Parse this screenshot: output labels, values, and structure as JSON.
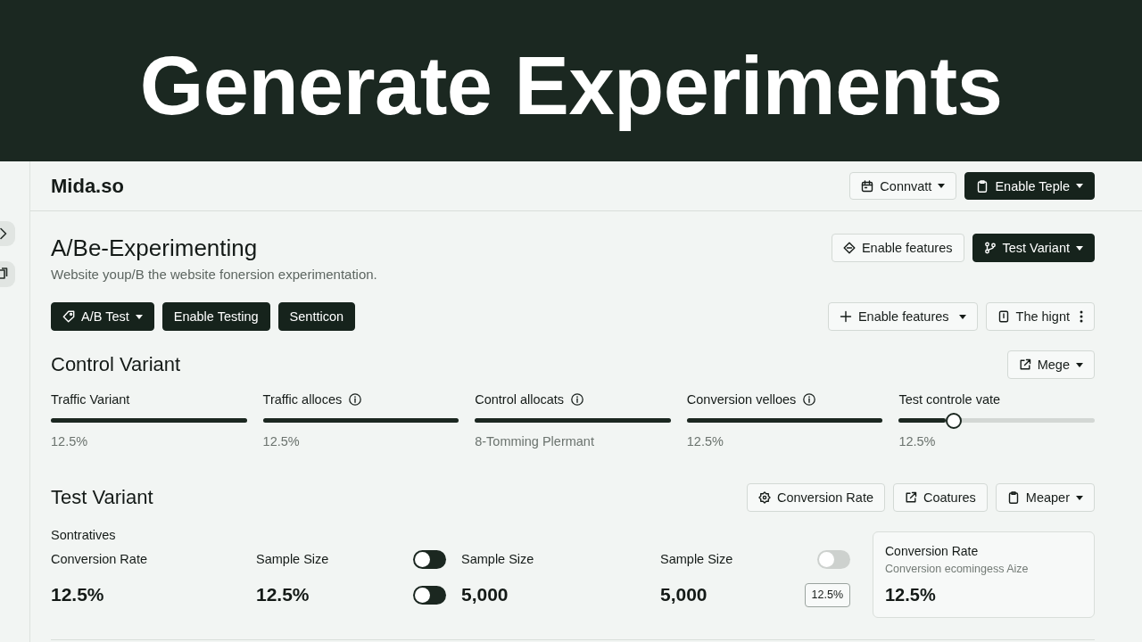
{
  "banner": {
    "title": "Generate Experiments"
  },
  "header": {
    "brand": "Mida.so",
    "buttons": [
      {
        "label": "Connvatt",
        "kind": "outline",
        "dropdown": true
      },
      {
        "label": "Enable Teple",
        "kind": "dark",
        "dropdown": true
      }
    ]
  },
  "experiment": {
    "title": "A/Be-Experimenting",
    "subtitle": "Website youp/B the website fonersion experimentation.",
    "actions": [
      {
        "label": "Enable features",
        "kind": "outline",
        "dropdown": false
      },
      {
        "label": "Test Variant",
        "kind": "dark",
        "dropdown": true
      }
    ],
    "toolbar": [
      {
        "label": "A/B Test",
        "kind": "dark",
        "dropdown": true
      },
      {
        "label": "Enable Testing",
        "kind": "dark",
        "dropdown": false
      },
      {
        "label": "Sentticon",
        "kind": "dark",
        "dropdown": false
      }
    ],
    "toolbar_right": [
      {
        "label": "Enable features",
        "kind": "outline",
        "dropdown": true,
        "more": false
      },
      {
        "label": "The hignt",
        "kind": "outline",
        "dropdown": false,
        "more": true
      }
    ]
  },
  "control_variant": {
    "title": "Control Variant",
    "actions": [
      {
        "label": "Mege",
        "kind": "outline",
        "dropdown": true
      }
    ],
    "sliders": [
      {
        "label": "Traffic Variant",
        "info": false,
        "kind": "bar",
        "level": 1,
        "reading": "12.5%"
      },
      {
        "label": "Traffic alloces",
        "info": true,
        "kind": "bar",
        "level": 1,
        "reading": "12.5%"
      },
      {
        "label": "Control allocats",
        "info": true,
        "kind": "bar",
        "level": 1,
        "reading": "8-Tomming Plermant"
      },
      {
        "label": "Conversion velloes",
        "info": true,
        "kind": "bar",
        "level": 1,
        "reading": "12.5%"
      },
      {
        "label": "Test controle vate",
        "info": false,
        "kind": "slider",
        "level": 0.28,
        "reading": "12.5%"
      }
    ]
  },
  "test_variant": {
    "title": "Test Variant",
    "actions": [
      {
        "label": "Conversion Rate",
        "kind": "outline",
        "dropdown": false
      },
      {
        "label": "Coatures",
        "kind": "outline",
        "dropdown": false
      },
      {
        "label": "Meaper",
        "kind": "outline",
        "dropdown": true
      }
    ],
    "group_label": "Sontratives",
    "metrics": [
      {
        "cells": [
          {
            "kind": "label",
            "text": "Conversion Rate"
          },
          {
            "kind": "label",
            "text": "Sample Size"
          },
          {
            "kind": "toggle",
            "on": false,
            "disabled": false
          },
          {
            "kind": "label",
            "text": "Sample Size"
          },
          {
            "kind": "label",
            "text": "Sample Size"
          },
          {
            "kind": "toggle",
            "on": false,
            "disabled": true
          }
        ]
      },
      {
        "cells": [
          {
            "kind": "value",
            "text": "12.5%"
          },
          {
            "kind": "value",
            "text": "12.5%"
          },
          {
            "kind": "toggle",
            "on": false,
            "disabled": false
          },
          {
            "kind": "value",
            "text": "5,000"
          },
          {
            "kind": "value",
            "text": "5,000"
          },
          {
            "kind": "badge",
            "text": "12.5%"
          }
        ]
      }
    ],
    "card": {
      "title": "Conversion Rate",
      "subtitle": "Conversion ecomingess Aize",
      "value": "12.5%"
    }
  }
}
